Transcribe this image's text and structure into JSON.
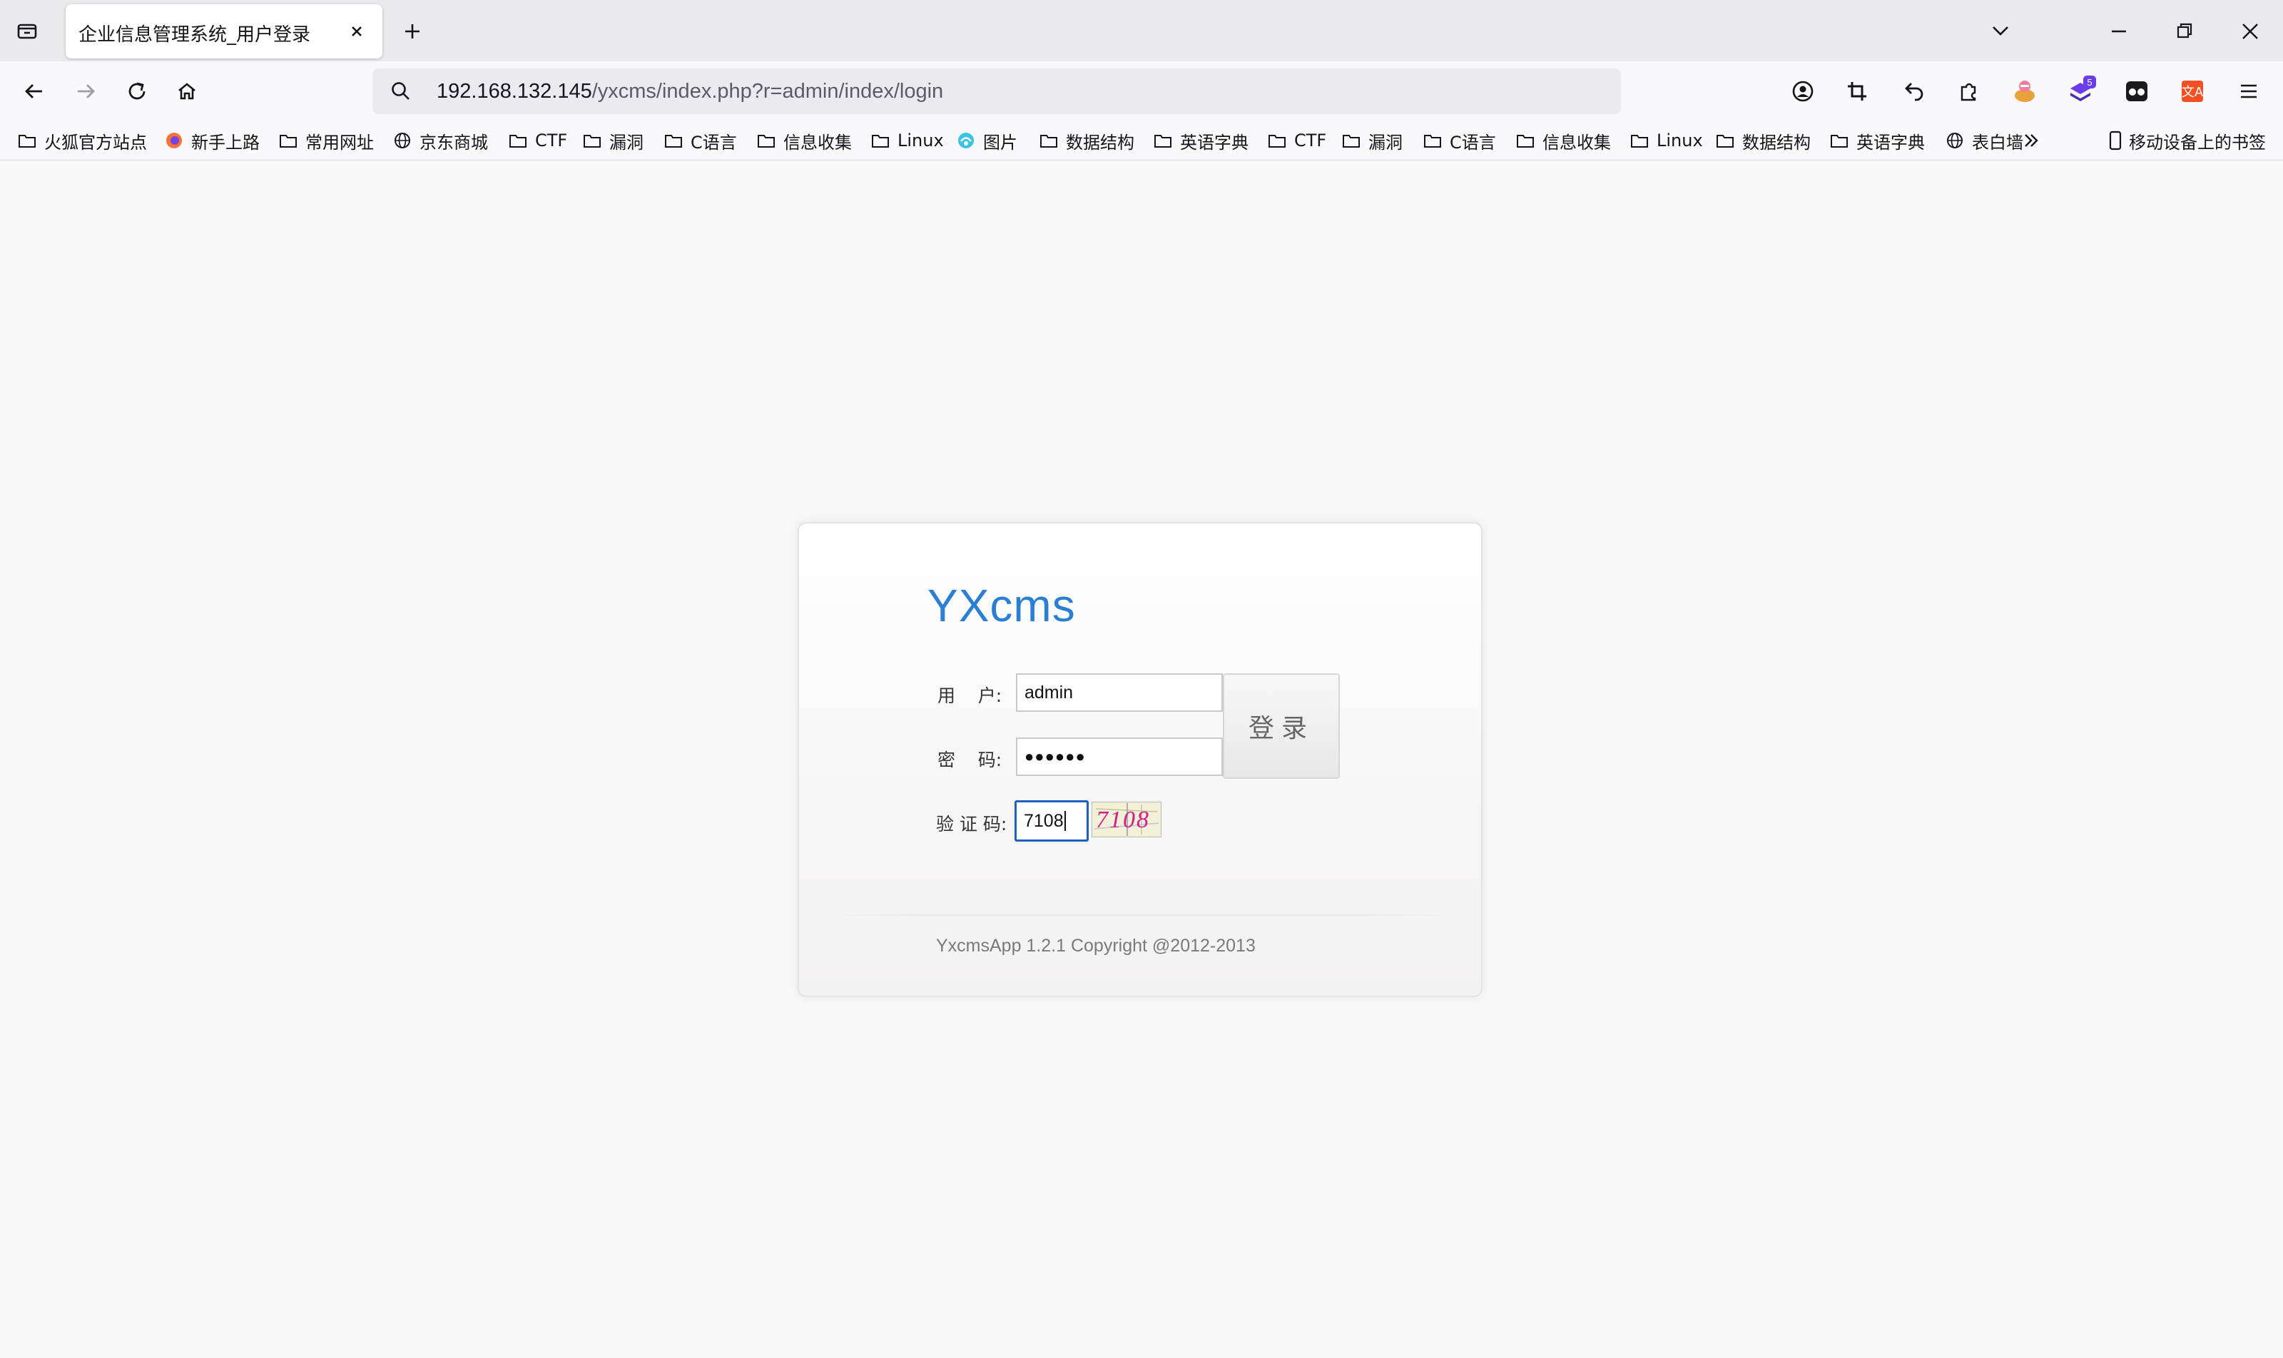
{
  "browser": {
    "tab_title": "企业信息管理系统_用户登录",
    "url_host": "192.168.132.145",
    "url_path": "/yxcms/index.php?r=admin/index/login",
    "extension_badge": "5"
  },
  "bookmarks": [
    {
      "label": "火狐官方站点",
      "icon": "folder-icon"
    },
    {
      "label": "新手上路",
      "icon": "firefox-icon"
    },
    {
      "label": "常用网址",
      "icon": "folder-icon"
    },
    {
      "label": "京东商城",
      "icon": "globe-icon"
    },
    {
      "label": "CTF",
      "icon": "folder-icon"
    },
    {
      "label": "漏洞",
      "icon": "folder-icon"
    },
    {
      "label": "C语言",
      "icon": "folder-icon"
    },
    {
      "label": "信息收集",
      "icon": "folder-icon"
    },
    {
      "label": "Linux",
      "icon": "folder-icon"
    },
    {
      "label": "图片",
      "icon": "image-site-icon"
    },
    {
      "label": "数据结构",
      "icon": "folder-icon"
    },
    {
      "label": "英语字典",
      "icon": "folder-icon"
    },
    {
      "label": "CTF",
      "icon": "folder-icon"
    },
    {
      "label": "漏洞",
      "icon": "folder-icon"
    },
    {
      "label": "C语言",
      "icon": "folder-icon"
    },
    {
      "label": "信息收集",
      "icon": "folder-icon"
    },
    {
      "label": "Linux",
      "icon": "folder-icon"
    },
    {
      "label": "数据结构",
      "icon": "folder-icon"
    },
    {
      "label": "英语字典",
      "icon": "folder-icon"
    },
    {
      "label": "表白墙",
      "icon": "globe-icon"
    }
  ],
  "mobile_bookmarks": "移动设备上的书签",
  "login": {
    "logo": "YXcms",
    "user_label": "用    户:",
    "user_value": "admin",
    "password_label": "密    码:",
    "password_value": "●●●●●●",
    "captcha_label": "验 证 码:",
    "captcha_value": "7108",
    "captcha_image_text": "7108",
    "submit": "登录",
    "copyright": "YxcmsApp 1.2.1 Copyright @2012-2013"
  }
}
